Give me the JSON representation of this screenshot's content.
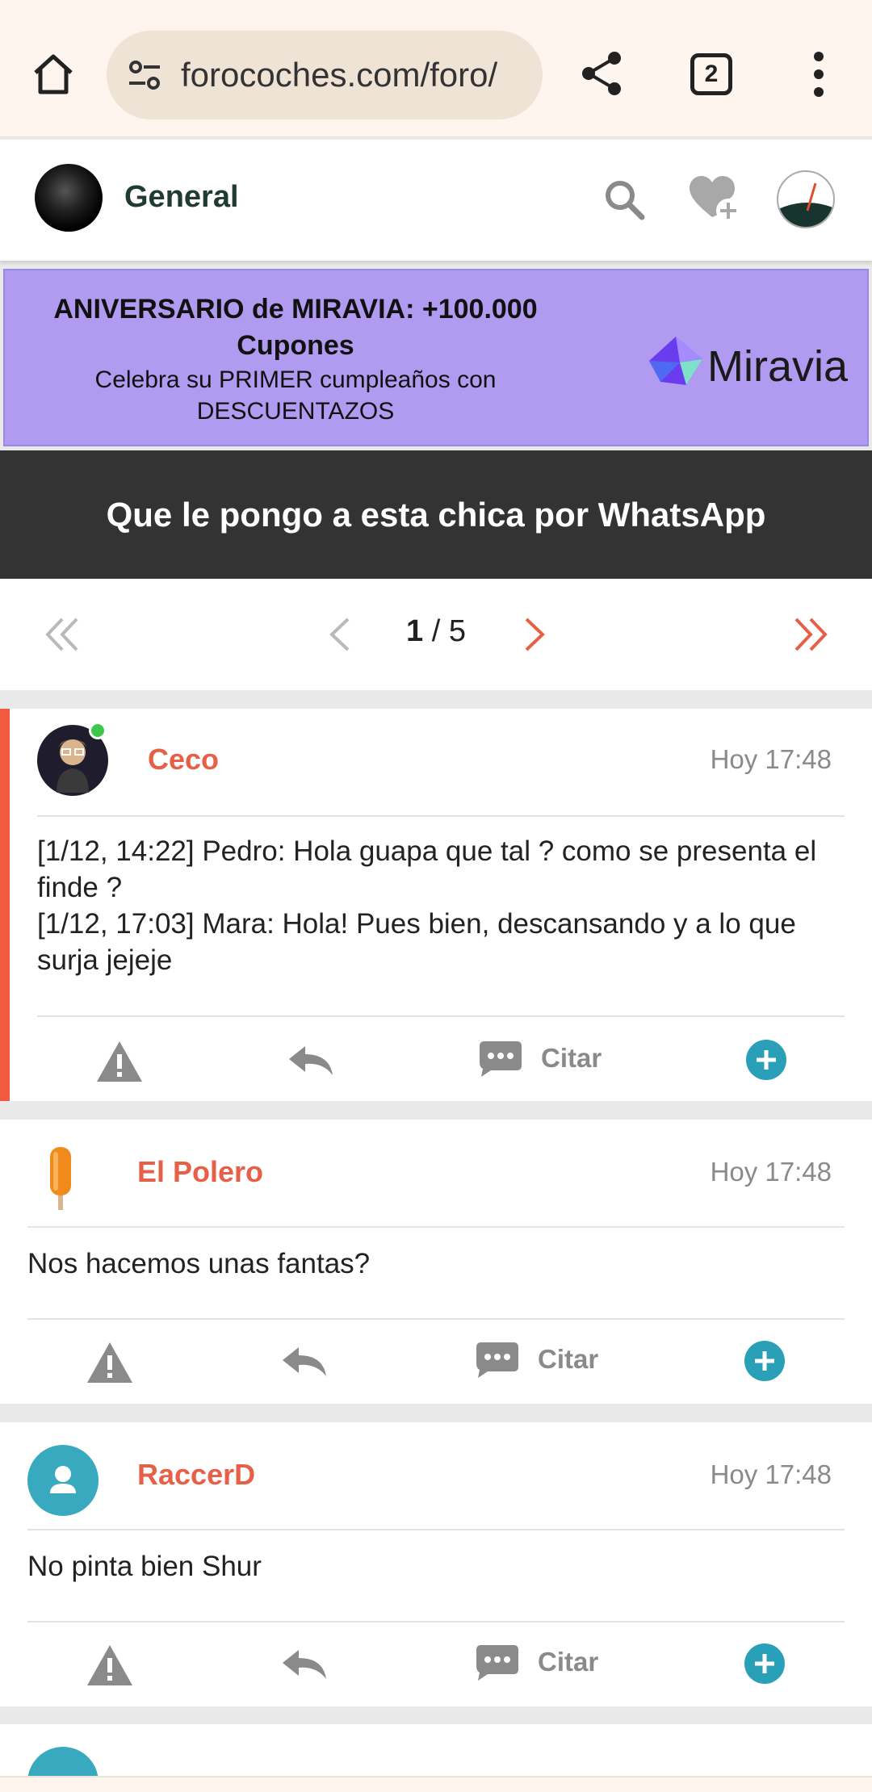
{
  "browser": {
    "url": "forocoches.com/foro/",
    "tab_count": "2"
  },
  "forum": {
    "section_title": "General"
  },
  "ad": {
    "title": "ANIVERSARIO de MIRAVIA: +100.000 Cupones",
    "subtitle": "Celebra su PRIMER cumpleaños con DESCUENTAZOS",
    "brand": "Miravia",
    "background_color": "#b09bf0"
  },
  "thread": {
    "title": "Que le pongo a esta chica por WhatsApp"
  },
  "pagination": {
    "current": "1",
    "separator": " / ",
    "total": "5"
  },
  "posts": [
    {
      "user": "Ceco",
      "time": "Hoy 17:48",
      "body_lines": [
        "[1/12, 14:22] Pedro: Hola guapa que tal ? como se presenta el finde ?",
        "[1/12, 17:03] Mara: Hola! Pues bien, descansando y a lo que surja jejeje"
      ],
      "online": true,
      "quote_label": "Citar"
    },
    {
      "user": "El Polero",
      "time": "Hoy 17:48",
      "body_lines": [
        "Nos hacemos unas fantas?"
      ],
      "quote_label": "Citar"
    },
    {
      "user": "RaccerD",
      "time": "Hoy 17:48",
      "body_lines": [
        "No pinta bien Shur"
      ],
      "quote_label": "Citar"
    }
  ],
  "colors": {
    "accent": "#e85f48",
    "teal": "#2aa0b8",
    "dark_bar": "#333333"
  }
}
